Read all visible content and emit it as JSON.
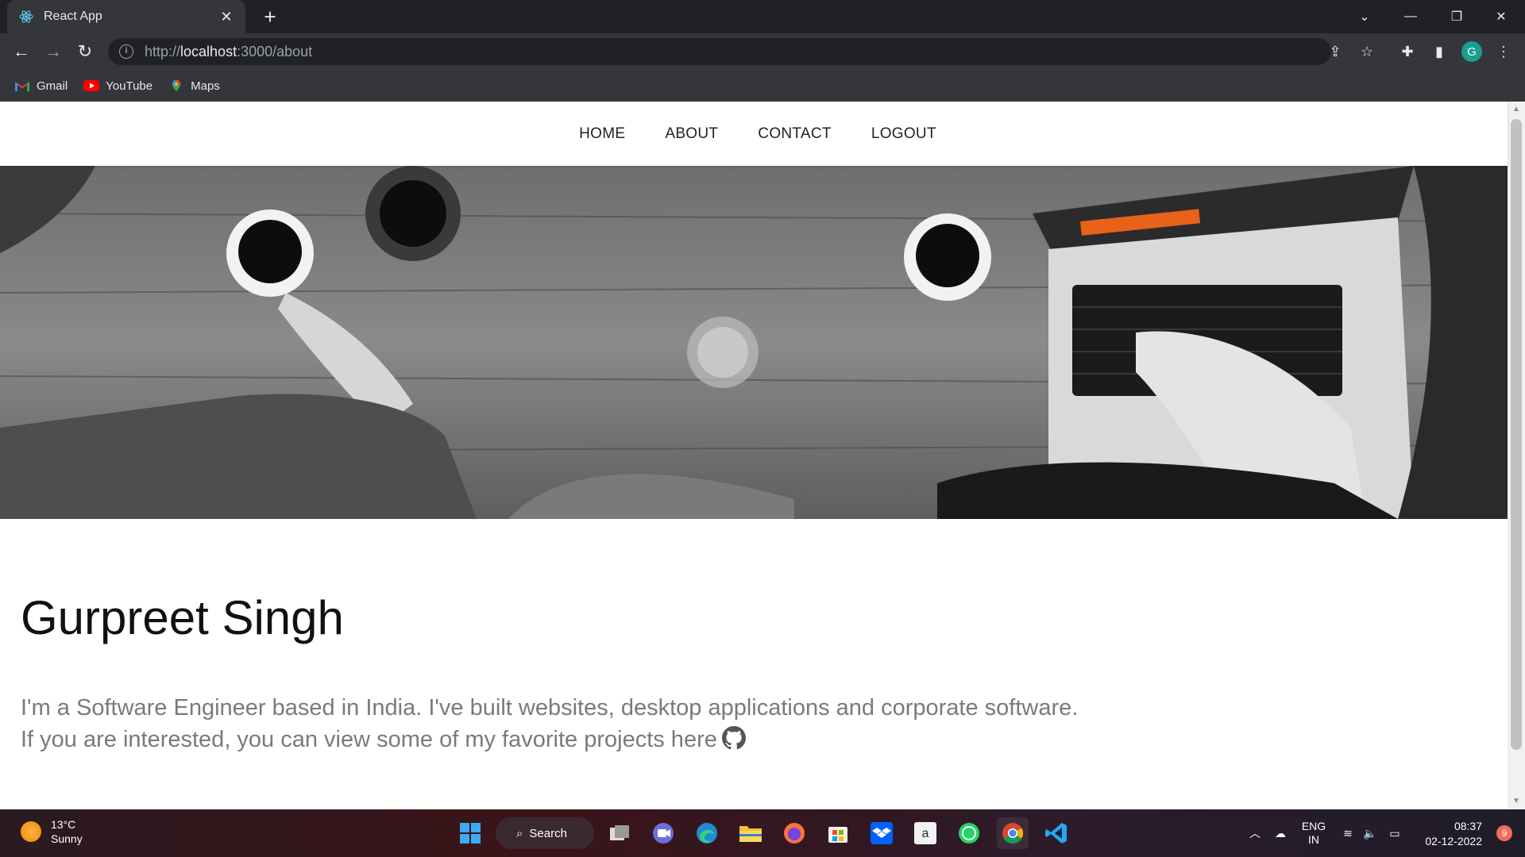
{
  "browser": {
    "tab_title": "React App",
    "url_prefix": "http://",
    "url_host": "localhost",
    "url_path": ":3000/about",
    "bookmarks": [
      {
        "label": "Gmail"
      },
      {
        "label": "YouTube"
      },
      {
        "label": "Maps"
      }
    ],
    "profile_initial": "G"
  },
  "site": {
    "nav": [
      "HOME",
      "ABOUT",
      "CONTACT",
      "LOGOUT"
    ],
    "name": "Gurpreet Singh",
    "bio_line1": "I'm a Software Engineer based in India. I've built websites, desktop applications and corporate software.",
    "bio_line2": "If you are interested, you can view some of my favorite projects here"
  },
  "taskbar": {
    "temperature": "13°C",
    "condition": "Sunny",
    "search_label": "Search",
    "lang_top": "ENG",
    "lang_bottom": "IN",
    "time": "08:37",
    "date": "02-12-2022",
    "notification_count": "9"
  },
  "colors": {
    "accent_teal": "#1a9e8e",
    "notif": "#f26b5b"
  }
}
